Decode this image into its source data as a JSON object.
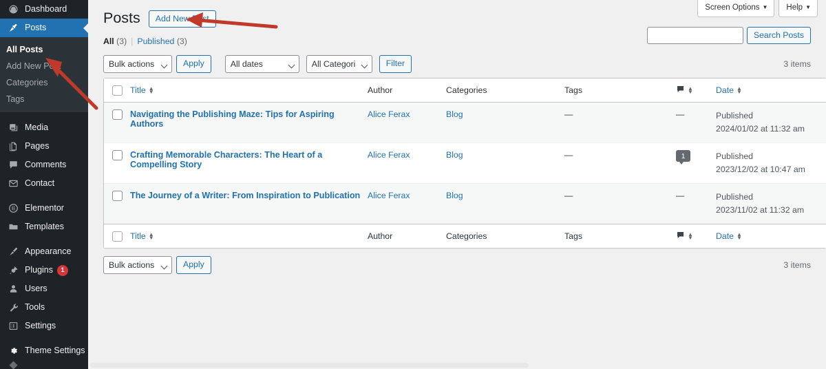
{
  "sidebar": {
    "items": [
      {
        "label": "Dashboard",
        "icon": "dashboard-icon",
        "state": "normal"
      },
      {
        "label": "Posts",
        "icon": "pin-icon",
        "state": "active"
      },
      {
        "label": "Media",
        "icon": "media-icon",
        "state": "normal"
      },
      {
        "label": "Pages",
        "icon": "pages-icon",
        "state": "normal"
      },
      {
        "label": "Comments",
        "icon": "comments-icon",
        "state": "normal"
      },
      {
        "label": "Contact",
        "icon": "envelope-icon",
        "state": "normal"
      },
      {
        "label": "Elementor",
        "icon": "elementor-icon",
        "state": "normal"
      },
      {
        "label": "Templates",
        "icon": "folder-icon",
        "state": "normal"
      },
      {
        "label": "Appearance",
        "icon": "brush-icon",
        "state": "normal"
      },
      {
        "label": "Plugins",
        "icon": "plug-icon",
        "state": "normal",
        "badge": "1"
      },
      {
        "label": "Users",
        "icon": "user-icon",
        "state": "normal"
      },
      {
        "label": "Tools",
        "icon": "wrench-icon",
        "state": "normal"
      },
      {
        "label": "Settings",
        "icon": "sliders-icon",
        "state": "normal"
      },
      {
        "label": "Theme Settings",
        "icon": "gear-icon",
        "state": "normal"
      }
    ],
    "submenu": [
      {
        "label": "All Posts",
        "current": true
      },
      {
        "label": "Add New Post",
        "current": false
      },
      {
        "label": "Categories",
        "current": false
      },
      {
        "label": "Tags",
        "current": false
      }
    ]
  },
  "screen_meta": {
    "screen_options": "Screen Options",
    "help": "Help",
    "caret": "▼"
  },
  "header": {
    "title": "Posts",
    "add_new_label": "Add New Post"
  },
  "views": {
    "all_label": "All",
    "all_count": "(3)",
    "divider": "|",
    "published_label": "Published",
    "published_count": "(3)"
  },
  "search": {
    "value": "",
    "placeholder": "",
    "button_label": "Search Posts"
  },
  "tablenav_top": {
    "bulk_actions": "Bulk actions",
    "apply_label": "Apply",
    "dates": "All dates",
    "categories": "All Categories",
    "filter_label": "Filter",
    "items_count": "3 items"
  },
  "tablenav_bottom": {
    "bulk_actions": "Bulk actions",
    "apply_label": "Apply",
    "items_count": "3 items"
  },
  "table": {
    "columns": {
      "title": "Title",
      "author": "Author",
      "categories": "Categories",
      "tags": "Tags",
      "comments": "comments-icon",
      "date": "Date"
    },
    "rows": [
      {
        "title": "Navigating the Publishing Maze: Tips for Aspiring Authors",
        "author": "Alice Ferax",
        "categories": "Blog",
        "tags": "—",
        "comments": "—",
        "comments_count": null,
        "status": "Published",
        "date": "2024/01/02 at 11:32 am"
      },
      {
        "title": "Crafting Memorable Characters: The Heart of a Compelling Story",
        "author": "Alice Ferax",
        "categories": "Blog",
        "tags": "—",
        "comments": "1",
        "comments_count": "1",
        "status": "Published",
        "date": "2023/12/02 at 10:47 am"
      },
      {
        "title": "The Journey of a Writer: From Inspiration to Publication",
        "author": "Alice Ferax",
        "categories": "Blog",
        "tags": "—",
        "comments": "—",
        "comments_count": null,
        "status": "Published",
        "date": "2023/11/02 at 11:32 am"
      }
    ]
  },
  "colors": {
    "sidebar_bg": "#1d2327",
    "submenu_bg": "#2c3338",
    "active_blue": "#2271b1",
    "link_blue": "#2271b1",
    "badge_red": "#d63638",
    "page_bg": "#f0f0f1",
    "annotation_red": "#c0392b"
  },
  "annotations": {
    "arrow_add_new": "arrow pointing left to Add New Post button",
    "arrow_all_posts": "arrow pointing up-left to All Posts menu item"
  }
}
